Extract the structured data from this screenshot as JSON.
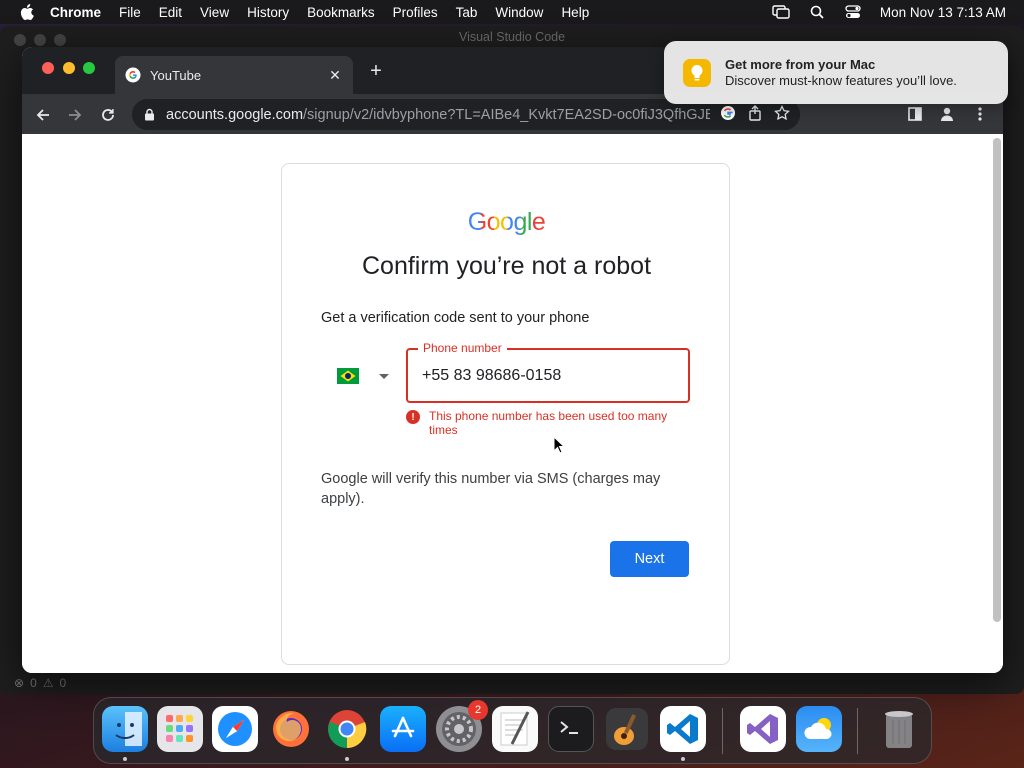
{
  "menubar": {
    "app": "Chrome",
    "items": [
      "File",
      "Edit",
      "View",
      "History",
      "Bookmarks",
      "Profiles",
      "Tab",
      "Window",
      "Help"
    ],
    "clock": "Mon Nov 13  7:13 AM"
  },
  "vscode": {
    "title": "Visual Studio Code",
    "status_errors": "0",
    "status_warnings": "0"
  },
  "chrome": {
    "tab_title": "YouTube",
    "url_host": "accounts.google.com",
    "url_path": "/signup/v2/idvbyphone?TL=AIBe4_Kvkt7EA2SD-oc0fiJ3QfhGJENorG5R..."
  },
  "page": {
    "logo": "Google",
    "heading": "Confirm you’re not a robot",
    "subtitle": "Get a verification code sent to your phone",
    "phone_label": "Phone number",
    "phone_value": "+55 83 98686-0158",
    "error_icon": "!",
    "error_text": "This phone number has been used too many times",
    "info_text": "Google will verify this number via SMS (charges may apply).",
    "next_label": "Next"
  },
  "notification": {
    "title": "Get more from your Mac",
    "body": "Discover must-know features you’ll love."
  },
  "dock": {
    "apps": [
      "Finder",
      "Launchpad",
      "Safari",
      "Firefox",
      "Google Chrome",
      "App Store",
      "System Settings",
      "TextEdit",
      "Terminal",
      "GarageBand",
      "Visual Studio Code",
      "Visual Studio",
      "Weather",
      "Trash"
    ],
    "settings_badge": "2"
  },
  "colors": {
    "accent_blue": "#1a73e8",
    "error_red": "#d93025"
  }
}
